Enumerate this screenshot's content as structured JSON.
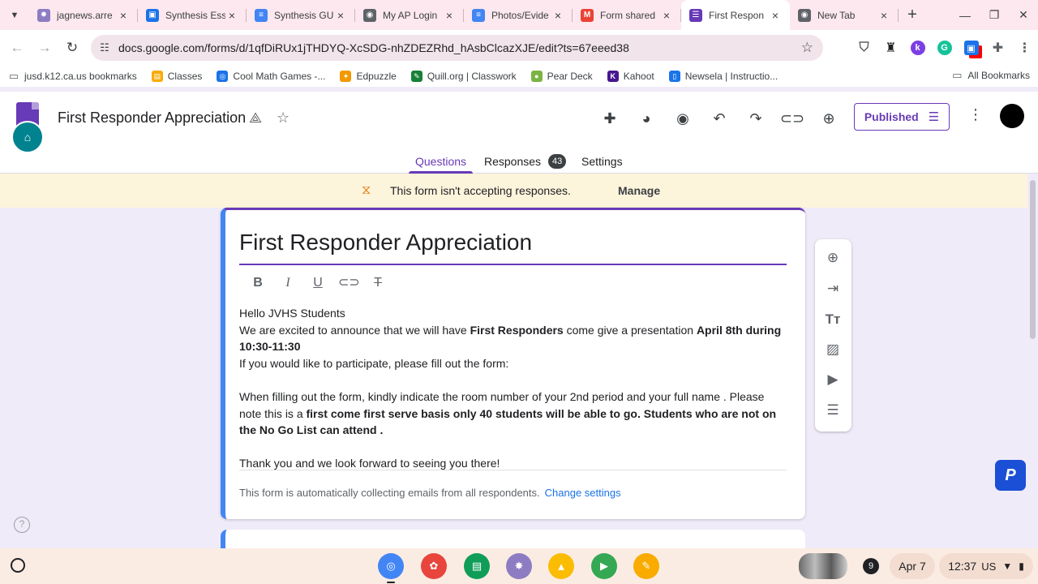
{
  "browser": {
    "tabs": [
      {
        "title": "jagnews.arre",
        "fav_color": "#8e7cc3",
        "fav_glyph": "✸"
      },
      {
        "title": "Synthesis Ess",
        "fav_color": "#1a73e8",
        "fav_glyph": "▣"
      },
      {
        "title": "Synthesis GU",
        "fav_color": "#4285f4",
        "fav_glyph": "≡"
      },
      {
        "title": "My AP Login",
        "fav_color": "#5f6368",
        "fav_glyph": "◉"
      },
      {
        "title": "Photos/Evide",
        "fav_color": "#4285f4",
        "fav_glyph": "≡"
      },
      {
        "title": "Form shared",
        "fav_color": "#ea4335",
        "fav_glyph": "M"
      },
      {
        "title": "First Respon",
        "fav_color": "#673ab7",
        "fav_glyph": "☰"
      },
      {
        "title": "New Tab",
        "fav_color": "#5f6368",
        "fav_glyph": "◉"
      }
    ],
    "new_tab_glyph": "+",
    "url": "docs.google.com/forms/d/1qfDiRUx1jTHDYQ-XcSDG-nhZDEZRhd_hAsbClcazXJE/edit?ts=67eeed38",
    "bookmarks": [
      {
        "label": "jusd.k12.ca.us bookmarks",
        "icon": "folder-icon",
        "color": "#5f6368",
        "glyph": "▭"
      },
      {
        "label": "Classes",
        "icon": "classroom-icon",
        "color": "#f9ab00",
        "glyph": "▤"
      },
      {
        "label": "Cool Math Games -...",
        "icon": "coolmath-icon",
        "color": "#1a73e8",
        "glyph": "◎"
      },
      {
        "label": "Edpuzzle",
        "icon": "edpuzzle-icon",
        "color": "#f29900",
        "glyph": "✦"
      },
      {
        "label": "Quill.org | Classwork",
        "icon": "quill-icon",
        "color": "#188038",
        "glyph": "✎"
      },
      {
        "label": "Pear Deck",
        "icon": "peardeck-icon",
        "color": "#7cb342",
        "glyph": "●"
      },
      {
        "label": "Kahoot",
        "icon": "kahoot-icon",
        "color": "#46178f",
        "glyph": "K"
      },
      {
        "label": "Newsela | Instructio...",
        "icon": "newsela-icon",
        "color": "#1a73e8",
        "glyph": "▯"
      }
    ],
    "all_bookmarks": "All Bookmarks",
    "extensions": [
      {
        "name": "shield-icon",
        "color": "#5f6368",
        "glyph": "⛉"
      },
      {
        "name": "spy-icon",
        "color": "#202124",
        "glyph": "♜"
      },
      {
        "name": "k-extension-icon",
        "color": "#7b3fe4",
        "glyph": "k"
      },
      {
        "name": "grammarly-icon",
        "color": "#15c39a",
        "glyph": "G"
      },
      {
        "name": "screencast-icon",
        "color": "#1a73e8",
        "glyph": "▣"
      },
      {
        "name": "puzzle-icon",
        "color": "#5f6368",
        "glyph": "✚"
      },
      {
        "name": "menu-dots-icon",
        "color": "#5f6368",
        "glyph": "⋮"
      }
    ]
  },
  "app": {
    "badge_glyph": "⌂",
    "title": "First Responder Appreciation",
    "published_label": "Published",
    "tabs": {
      "questions": "Questions",
      "responses": "Responses",
      "responses_count": "43",
      "settings": "Settings"
    }
  },
  "banner": {
    "text": "This form isn't accepting responses.",
    "manage": "Manage"
  },
  "form": {
    "title": "First Responder Appreciation",
    "description": [
      [
        {
          "t": "Hello JVHS Students",
          "b": false
        }
      ],
      [
        {
          "t": "We are excited to announce that we will have ",
          "b": false
        },
        {
          "t": "First Responders",
          "b": true
        },
        {
          "t": " come give a presentation ",
          "b": false
        },
        {
          "t": "April 8th during 10:30-11:30",
          "b": true
        }
      ],
      [
        {
          "t": "If you would like to participate, please fill out the form:",
          "b": false
        }
      ],
      [],
      [
        {
          "t": "When filling out the form, kindly indicate the room number of your 2nd period and your full name . Please note this is a ",
          "b": false
        },
        {
          "t": "first come first serve basis only 40 students will be able to go. Students who are not on the No Go List can attend .",
          "b": true
        }
      ],
      [],
      [
        {
          "t": "Thank you and we look forward to seeing you there!",
          "b": false
        }
      ]
    ],
    "collecting_text": "This form is automatically collecting emails from all respondents.",
    "change_settings": "Change settings"
  },
  "shelf": {
    "apps": [
      {
        "name": "chrome-icon",
        "color": "#4285f4",
        "glyph": "◎",
        "running": true
      },
      {
        "name": "canvas-paint-icon",
        "color": "#e8453c",
        "glyph": "✿",
        "running": false
      },
      {
        "name": "classroom-app-icon",
        "color": "#0f9d58",
        "glyph": "▤",
        "running": false
      },
      {
        "name": "jag-app-icon",
        "color": "#8e7cc3",
        "glyph": "✸",
        "running": false
      },
      {
        "name": "drive-icon",
        "color": "#fbbc04",
        "glyph": "▲",
        "running": false
      },
      {
        "name": "play-store-icon",
        "color": "#34a853",
        "glyph": "▶",
        "running": false
      },
      {
        "name": "keep-icon",
        "color": "#f9ab00",
        "glyph": "✎",
        "running": false
      }
    ],
    "notification_count": "9",
    "date": "Apr 7",
    "time": "12:37",
    "locale": "US"
  }
}
